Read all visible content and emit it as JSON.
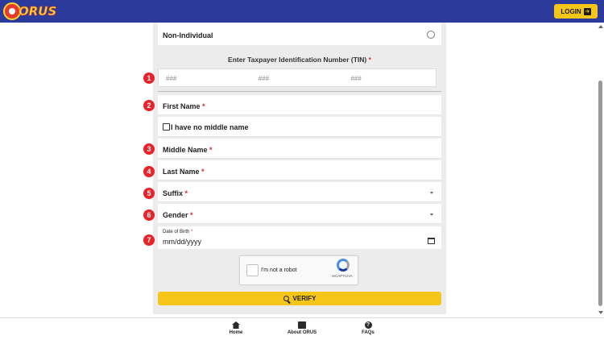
{
  "header": {
    "logo_text": "ORUS",
    "login_label": "LOGIN",
    "colors": {
      "bar": "#2c3a9c",
      "accent": "#f5c518"
    }
  },
  "form": {
    "non_individual_label": "Non-Individual",
    "tin_label": "Enter Taxpayer Identification Number (TIN)",
    "required_mark": "*",
    "tin_placeholders": [
      "###",
      "###",
      "###"
    ],
    "first_name_label": "First Name",
    "no_middle_name_label": "I have no middle name",
    "middle_name_label": "Middle Name",
    "last_name_label": "Last Name",
    "suffix_label": "Suffix",
    "gender_label": "Gender",
    "dob_label": "Date of Birth",
    "dob_placeholder": "mm/dd/yyyy",
    "captcha_text": "I'm not a robot",
    "captcha_brand": "reCAPTCHA",
    "verify_label": "VERIFY"
  },
  "markers": [
    "1",
    "2",
    "3",
    "4",
    "5",
    "6",
    "7"
  ],
  "bottom_nav": {
    "home": "Home",
    "about": "About ORUS",
    "faqs": "FAQs"
  },
  "icons": [
    "home-icon",
    "chat-icon",
    "question-icon",
    "search-icon",
    "login-icon",
    "calendar-icon",
    "chevron-down-icon"
  ]
}
